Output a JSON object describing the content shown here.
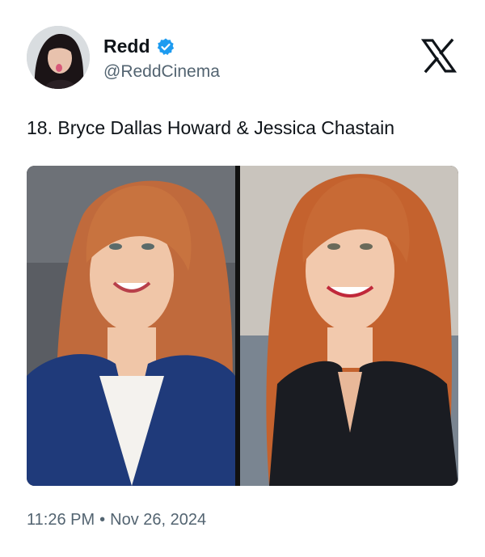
{
  "author": {
    "display_name": "Redd",
    "handle": "@ReddCinema",
    "avatar_icon": "profile-avatar",
    "verified_icon": "verified-badge-icon",
    "verified_color": "#1d9bf0"
  },
  "platform": {
    "logo_icon": "x-logo-icon"
  },
  "tweet": {
    "text": "18. Bryce Dallas Howard & Jessica Chastain",
    "time": "11:26 PM",
    "separator": "•",
    "date": "Nov 26, 2024"
  },
  "media": {
    "panels": [
      {
        "subject": "red-haired woman in navy blazer smiling"
      },
      {
        "subject": "red-haired woman in black vest smiling by the sea"
      }
    ]
  },
  "colors": {
    "text_primary": "#0f1419",
    "text_secondary": "#536471",
    "background": "#ffffff"
  }
}
